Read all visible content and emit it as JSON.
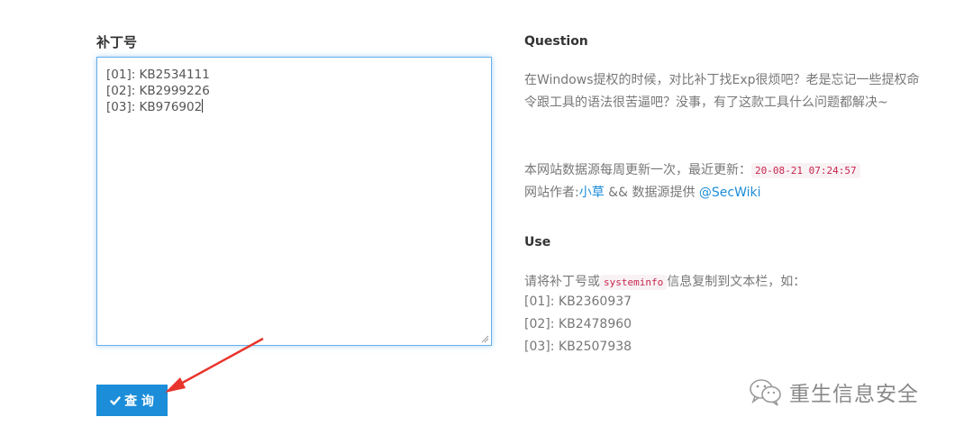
{
  "form": {
    "label": "补丁号",
    "textarea_lines": [
      "[01]: KB2534111",
      "[02]: KB2999226",
      "[03]: KB976902"
    ],
    "submit_label": "查 询",
    "submit_icon": "check-icon"
  },
  "info": {
    "question_heading": "Question",
    "question_text": "在Windows提权的时候，对比补丁找Exp很烦吧？老是忘记一些提权命令跟工具的语法很苦逼吧？没事，有了这款工具什么问题都解决~",
    "update_prefix": "本网站数据源每周更新一次，最近更新：",
    "update_time": "20-08-21 07:24:57",
    "author_prefix": "网站作者:",
    "author_link": "小草",
    "author_mid": " && 数据源提供 ",
    "source_link": "@SecWiki",
    "use_heading": "Use",
    "use_prefix": "请将补丁号或",
    "use_code": "systeminfo",
    "use_suffix": "信息复制到文本栏，如：",
    "examples": [
      "[01]: KB2360937",
      "[02]: KB2478960",
      "[03]: KB2507938"
    ]
  },
  "watermark": {
    "text": "重生信息安全",
    "icon": "wechat-icon"
  },
  "colors": {
    "accent": "#1c8dd9",
    "arrow": "#e8342b",
    "code_text": "#c7254e"
  }
}
